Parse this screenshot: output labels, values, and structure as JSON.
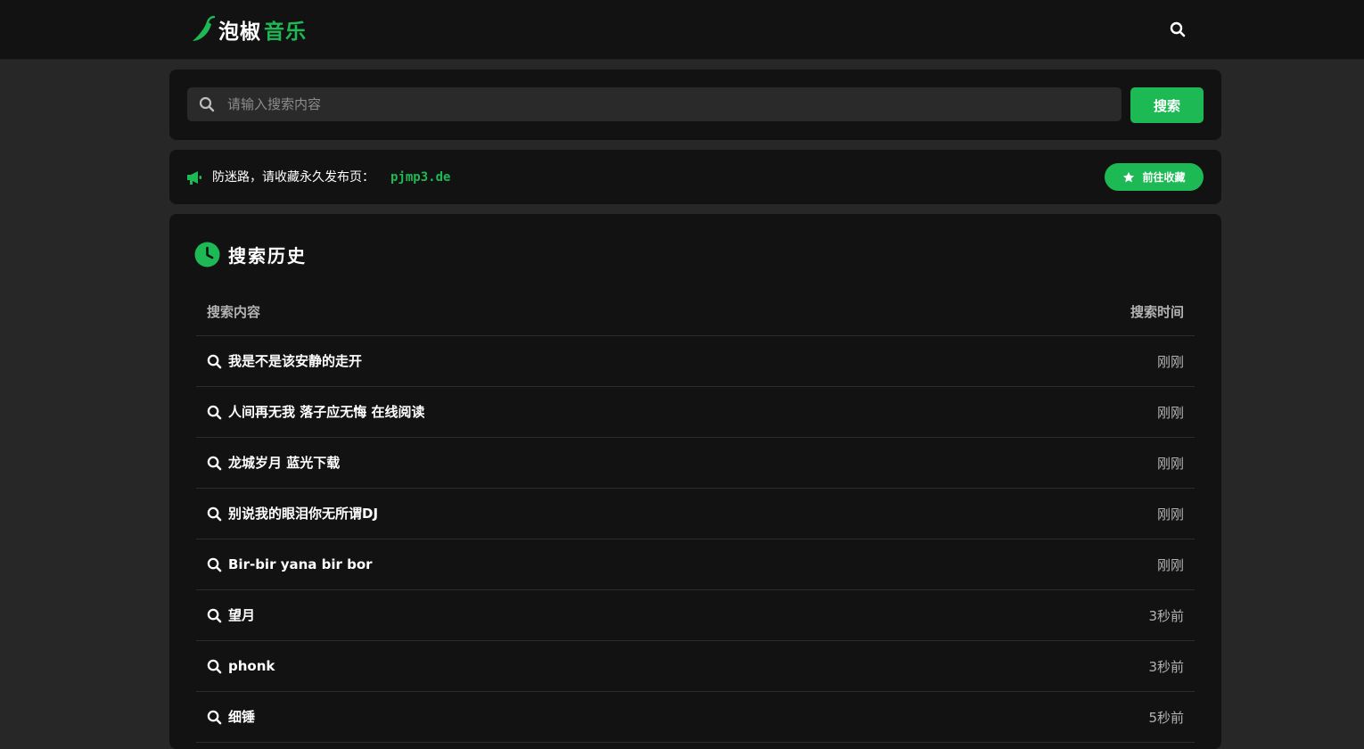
{
  "header": {
    "logo_part1": "泡椒",
    "logo_part2": "音乐"
  },
  "search": {
    "placeholder": "请输入搜索内容",
    "button_label": "搜索"
  },
  "notice": {
    "text": "防迷路，请收藏永久发布页：",
    "domain": "pjmp3.de",
    "button_label": "前往收藏"
  },
  "history": {
    "title": "搜索历史",
    "col_content": "搜索内容",
    "col_time": "搜索时间",
    "rows": [
      {
        "query": "我是不是该安静的走开",
        "time": "刚刚"
      },
      {
        "query": "人间再无我 落子应无悔 在线阅读",
        "time": "刚刚"
      },
      {
        "query": "龙城岁月 蓝光下载",
        "time": "刚刚"
      },
      {
        "query": "别说我的眼泪你无所谓DJ",
        "time": "刚刚"
      },
      {
        "query": "Bir-bir yana bir bor",
        "time": "刚刚"
      },
      {
        "query": "望月",
        "time": "3秒前"
      },
      {
        "query": "phonk",
        "time": "3秒前"
      },
      {
        "query": "细锤",
        "time": "5秒前"
      }
    ]
  },
  "colors": {
    "accent": "#1db954",
    "page_bg": "#272727",
    "card_bg": "#121212"
  },
  "icons": {
    "logo": "chili-pepper-icon",
    "top_search": "search-icon",
    "input_search": "search-icon",
    "notice": "megaphone-icon",
    "favorite": "star-icon",
    "history": "clock-icon",
    "row": "search-icon"
  }
}
